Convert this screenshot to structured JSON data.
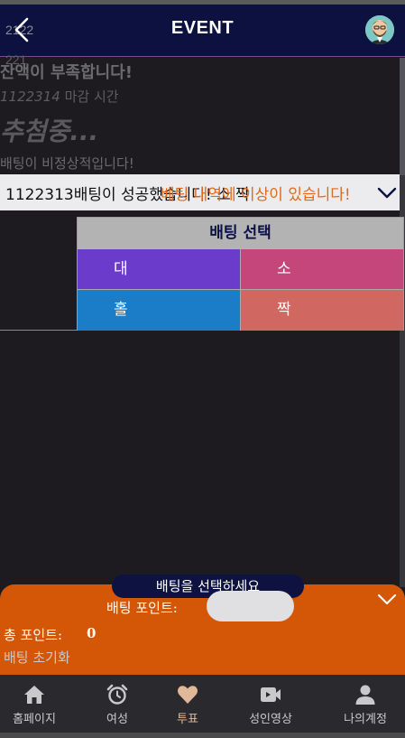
{
  "header": {
    "title": "EVENT",
    "ghost_top": "2122",
    "ghost_bottom": "221"
  },
  "background_messages": {
    "insufficient_balance": "잔액이 부족합니다!",
    "deadline_number": "1122314",
    "deadline_suffix": " 마감 시간",
    "drawing": "추첨중...",
    "abnormal_bet": "배팅이 비정상적입니다!"
  },
  "notification": {
    "text_primary": "1122313배팅이 성공했습니다! 소 짝",
    "text_overlay": "베팅 내역에 이상이 있습니다!"
  },
  "bet_table": {
    "header": "배팅 선택",
    "options": {
      "big": "대",
      "small": "소",
      "odd": "홀",
      "even": "짝"
    }
  },
  "bet_sheet": {
    "prompt": "배팅을 선택하세요",
    "bet_points_label": "배팅 포인트:",
    "bet_points_value": "",
    "total_points_label": "총 포인트:",
    "total_points_value": "0",
    "reset": "배팅 초기화"
  },
  "nav": [
    {
      "label": "홈페이지",
      "icon": "home-icon"
    },
    {
      "label": "여성",
      "icon": "alarm-clock-icon"
    },
    {
      "label": "투표",
      "icon": "heart-icon"
    },
    {
      "label": "성인영상",
      "icon": "video-camera-icon"
    },
    {
      "label": "나의계정",
      "icon": "user-icon"
    }
  ],
  "colors": {
    "header_bg": "#0c1140",
    "accent_orange": "#d35706",
    "big": "#6b3ccc",
    "small": "#c4467a",
    "odd": "#1b7cc8",
    "even": "#d06761",
    "nav_active": "#e0b89a"
  }
}
